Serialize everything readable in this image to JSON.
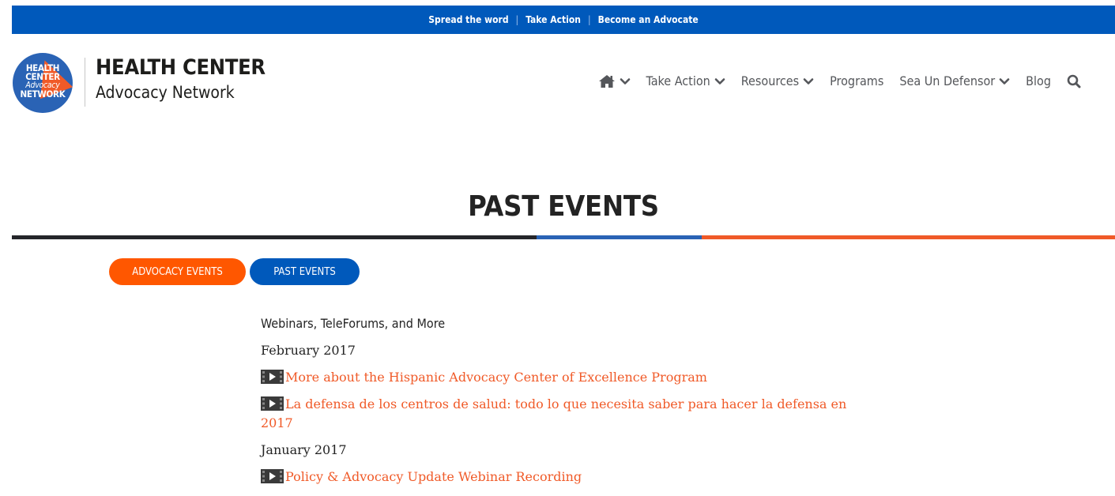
{
  "topbar": {
    "links": [
      "Spread the word",
      "Take Action",
      "Become an Advocate"
    ],
    "separator": "|"
  },
  "logo": {
    "badge_lines": [
      "HEALTH",
      "CENTER",
      "Advocacy",
      "NETWORK"
    ],
    "title": "HEALTH CENTER",
    "subtitle": "Advocacy Network"
  },
  "nav": {
    "items": [
      {
        "label": "Take Action",
        "dropdown": true
      },
      {
        "label": "Resources",
        "dropdown": true
      },
      {
        "label": "Programs",
        "dropdown": false
      },
      {
        "label": "Sea Un Defensor",
        "dropdown": true
      },
      {
        "label": "Blog",
        "dropdown": false
      }
    ],
    "icons": [
      "home-icon",
      "search-icon",
      "chevron-down-icon"
    ]
  },
  "page": {
    "title": "PAST EVENTS"
  },
  "tabs": {
    "advocacy_events": "ADVOCACY EVENTS",
    "past_events": "PAST EVENTS"
  },
  "content": {
    "heading": "Webinars, TeleForums, and More",
    "months": [
      "February 2017",
      "January 2017"
    ],
    "links": [
      "More about the Hispanic Advocacy Center of Excellence Program",
      "La defensa de los centros de salud: todo lo que necesita saber para hacer la defensa en 2017",
      "Policy & Advocacy Update Webinar Recording"
    ]
  },
  "colors": {
    "blue": "#0059bb",
    "orange": "#ff5700",
    "link_orange": "#f05a28",
    "dark": "#25262a"
  }
}
